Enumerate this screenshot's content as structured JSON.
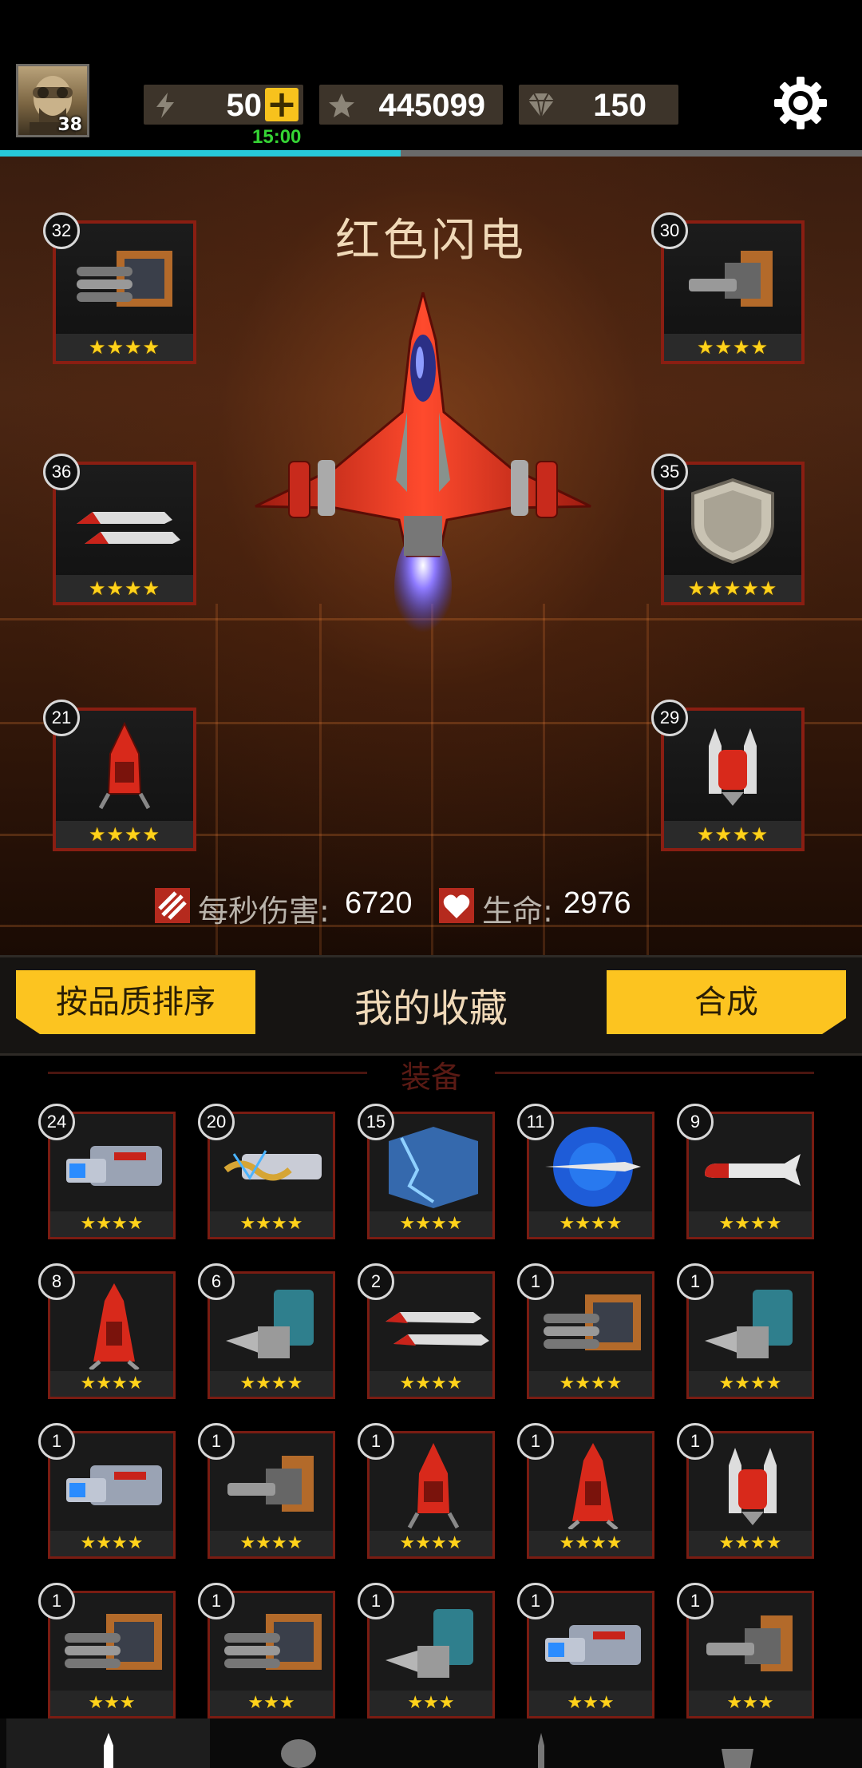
{
  "player": {
    "level": "38"
  },
  "resources": {
    "energy": "50",
    "energy_plus": "+",
    "energy_timer": "15:00",
    "stars": "445099",
    "gems": "150",
    "xp_progress": 0.465
  },
  "ship": {
    "name": "红色闪电",
    "slots": [
      {
        "level": "32",
        "stars": "★★★★",
        "item": "gatling-turret"
      },
      {
        "level": "30",
        "stars": "★★★★",
        "item": "cannon-turret"
      },
      {
        "level": "36",
        "stars": "★★★★",
        "item": "twin-missiles"
      },
      {
        "level": "35",
        "stars": "★★★★★",
        "item": "shield"
      },
      {
        "level": "21",
        "stars": "★★★★",
        "item": "red-drone"
      },
      {
        "level": "29",
        "stars": "★★★★",
        "item": "twin-rocket-drone"
      }
    ],
    "dps_label": "每秒伤害:",
    "dps_value": "6720",
    "hp_label": "生命:",
    "hp_value": "2976"
  },
  "collection": {
    "sort_label": "按品质排序",
    "title": "我的收藏",
    "merge_label": "合成",
    "section": "装备",
    "items": [
      {
        "level": "24",
        "stars": "★★★★",
        "item": "laser-cannon"
      },
      {
        "level": "20",
        "stars": "★★★★",
        "item": "tesla-gun"
      },
      {
        "level": "15",
        "stars": "★★★★",
        "item": "energy-shield"
      },
      {
        "level": "11",
        "stars": "★★★★",
        "item": "plasma-missile"
      },
      {
        "level": "9",
        "stars": "★★★★",
        "item": "single-missile"
      },
      {
        "level": "8",
        "stars": "★★★★",
        "item": "red-drone-tall"
      },
      {
        "level": "6",
        "stars": "★★★★",
        "item": "drill-cannon"
      },
      {
        "level": "2",
        "stars": "★★★★",
        "item": "twin-missiles"
      },
      {
        "level": "1",
        "stars": "★★★★",
        "item": "gatling-turret"
      },
      {
        "level": "1",
        "stars": "★★★★",
        "item": "drill-cannon"
      },
      {
        "level": "1",
        "stars": "★★★★",
        "item": "laser-cannon"
      },
      {
        "level": "1",
        "stars": "★★★★",
        "item": "cannon-turret"
      },
      {
        "level": "1",
        "stars": "★★★★",
        "item": "red-drone"
      },
      {
        "level": "1",
        "stars": "★★★★",
        "item": "red-drone-tall"
      },
      {
        "level": "1",
        "stars": "★★★★",
        "item": "twin-rocket-drone"
      },
      {
        "level": "1",
        "stars": "★★★",
        "item": "gatling-turret"
      },
      {
        "level": "1",
        "stars": "★★★",
        "item": "gatling-turret"
      },
      {
        "level": "1",
        "stars": "★★★",
        "item": "drill-cannon"
      },
      {
        "level": "1",
        "stars": "★★★",
        "item": "laser-cannon"
      },
      {
        "level": "1",
        "stars": "★★★",
        "item": "cannon-turret"
      }
    ]
  },
  "icons": {
    "settings": "gear-icon",
    "energy": "lightning-icon",
    "stars": "star-icon",
    "gems": "diamond-icon",
    "dps": "damage-icon",
    "hp": "heart-shield-icon"
  },
  "colors": {
    "accent_yellow": "#fcc420",
    "frame_red": "#8a1e12",
    "progress_cyan": "#27c8d8",
    "timer_green": "#35d434"
  }
}
